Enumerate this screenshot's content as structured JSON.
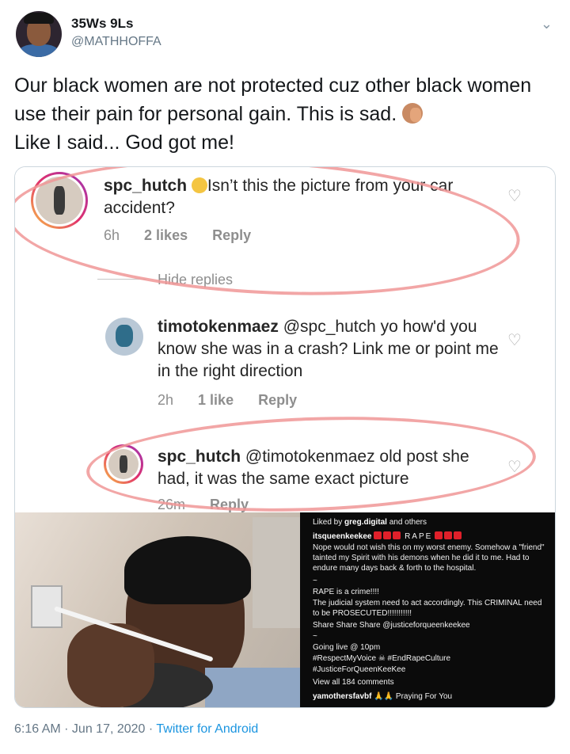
{
  "author": {
    "name": "35Ws 9Ls",
    "handle": "@MATHHOFFA"
  },
  "tweet": {
    "text": "Our black women are not protected cuz other black women use their pain for personal gain. This is sad.",
    "text2": "Like I said... God got me!"
  },
  "comments": {
    "first": {
      "user": "spc_hutch",
      "text": "Isn’t this the picture from your car accident?",
      "time": "6h",
      "likes": "2 likes",
      "reply": "Reply"
    },
    "hide_replies": "Hide replies",
    "second": {
      "user": "timotokenmaez",
      "text": "@spc_hutch yo how'd you know she was in a crash? Link me or point me in the right direction",
      "time": "2h",
      "likes": "1 like",
      "reply": "Reply"
    },
    "third": {
      "user": "spc_hutch",
      "text": "@timotokenmaez old post she had, it was the same exact picture",
      "time": "26m",
      "reply": "Reply"
    }
  },
  "insta_post": {
    "liked_by_prefix": "Liked by",
    "liked_by_user": "greg.digital",
    "liked_by_suffix": "and others",
    "poster": "itsqueenkeekee",
    "rape_word": "RAPE",
    "caption1": "Nope would not wish this on my worst enemy. Somehow a \"friend\" tainted my Spirit with his demons when he did it to me. Had to endure many days back & forth to the hospital.",
    "tilde1": "~",
    "caption2": "RAPE is a crime!!!!",
    "caption3": "The judicial system need to act accordingly. This CRIMINAL need to be PROSECUTED!!!!!!!!!!!",
    "caption4": "Share Share Share @justiceforqueenkeekee",
    "tilde2": "~",
    "caption5": "Going live @ 10pm",
    "caption6": "#RespectMyVoice ☠ #EndRapeCulture",
    "caption7": "#JusticeForQueenKeeKee",
    "view_all": "View all 184 comments",
    "commenter": "yamothersfavbf",
    "commenter_text": "🙏🙏 Praying For You"
  },
  "footer": {
    "time": "6:16 AM · Jun 17, 2020 · ",
    "source": "Twitter for Android"
  },
  "colors": {
    "link": "#1b95e0",
    "secondary": "#657786",
    "annotation": "#f09696"
  }
}
